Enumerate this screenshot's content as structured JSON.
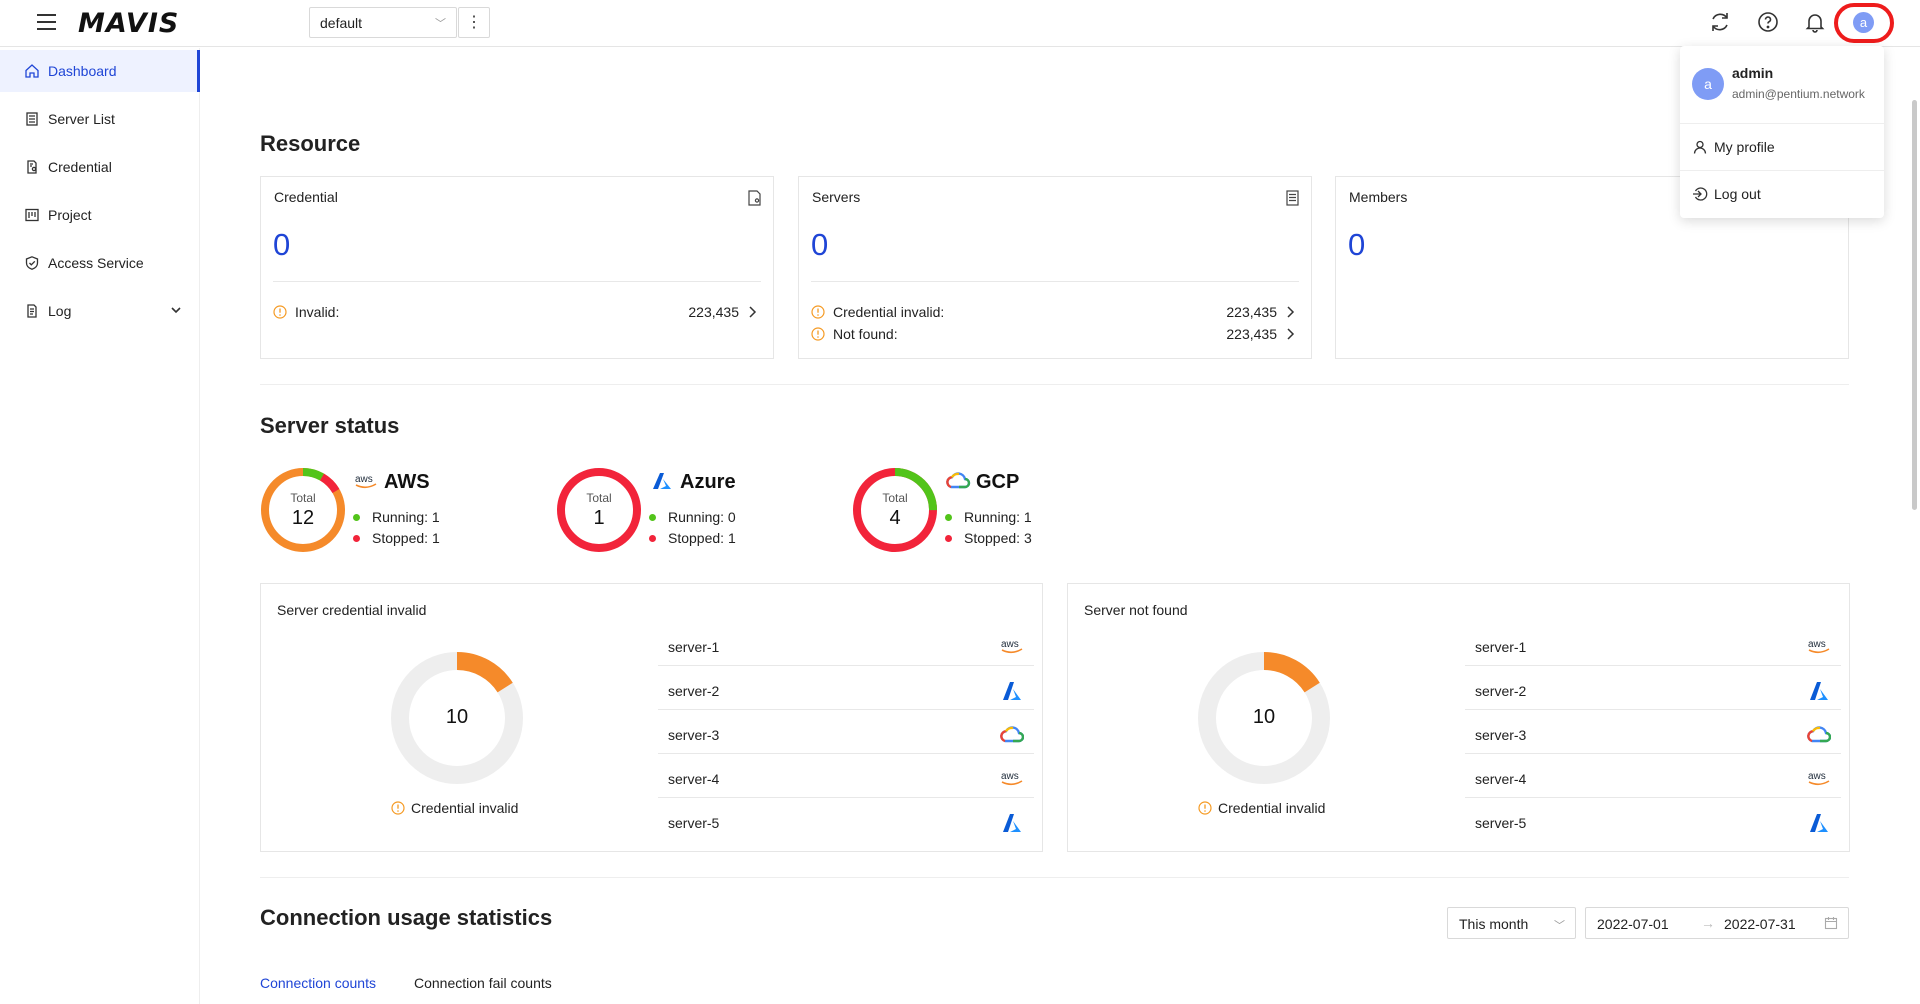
{
  "header": {
    "logo": "MAVIS",
    "project_selector": "default",
    "more_menu": "⋮",
    "user_avatar_letter": "a"
  },
  "sidebar": {
    "items": [
      {
        "label": "Dashboard",
        "icon": "home-icon",
        "active": true
      },
      {
        "label": "Server List",
        "icon": "server-list-icon"
      },
      {
        "label": "Credential",
        "icon": "credential-icon"
      },
      {
        "label": "Project",
        "icon": "project-icon"
      },
      {
        "label": "Access Service",
        "icon": "shield-icon"
      },
      {
        "label": "Log",
        "icon": "log-icon",
        "expandable": true
      }
    ]
  },
  "resource": {
    "title": "Resource",
    "cards": [
      {
        "title": "Credential",
        "value": "0",
        "rows": [
          {
            "label": "Invalid:",
            "value": "223,435"
          }
        ]
      },
      {
        "title": "Servers",
        "value": "0",
        "rows": [
          {
            "label": "Credential invalid:",
            "value": "223,435"
          },
          {
            "label": "Not found:",
            "value": "223,435"
          }
        ]
      },
      {
        "title": "Members",
        "value": "0",
        "rows": []
      }
    ]
  },
  "server_status": {
    "title": "Server status",
    "total_label": "Total",
    "providers": [
      {
        "name": "AWS",
        "total": "12",
        "running": "Running: 1",
        "stopped": "Stopped: 1",
        "running_count": 1,
        "stopped_count": 1
      },
      {
        "name": "Azure",
        "total": "1",
        "running": "Running: 0",
        "stopped": "Stopped: 1",
        "running_count": 0,
        "stopped_count": 1
      },
      {
        "name": "GCP",
        "total": "4",
        "running": "Running: 1",
        "stopped": "Stopped: 3",
        "running_count": 1,
        "stopped_count": 3
      }
    ]
  },
  "panels": [
    {
      "title": "Server credential invalid",
      "total": "10",
      "legend": "Credential invalid",
      "servers": [
        {
          "name": "server-1",
          "provider": "aws"
        },
        {
          "name": "server-2",
          "provider": "azure"
        },
        {
          "name": "server-3",
          "provider": "gcp"
        },
        {
          "name": "server-4",
          "provider": "aws"
        },
        {
          "name": "server-5",
          "provider": "azure"
        }
      ]
    },
    {
      "title": "Server not found",
      "total": "10",
      "legend": "Credential invalid",
      "servers": [
        {
          "name": "server-1",
          "provider": "aws"
        },
        {
          "name": "server-2",
          "provider": "azure"
        },
        {
          "name": "server-3",
          "provider": "gcp"
        },
        {
          "name": "server-4",
          "provider": "aws"
        },
        {
          "name": "server-5",
          "provider": "azure"
        }
      ]
    }
  ],
  "usage": {
    "title": "Connection usage statistics",
    "range_select": "This month",
    "date_from": "2022-07-01",
    "date_to": "2022-07-31",
    "tabs": [
      "Connection counts",
      "Connection fail counts"
    ]
  },
  "user_menu": {
    "name": "admin",
    "email": "admin@pentium.network",
    "avatar_letter": "a",
    "items": [
      "My profile",
      "Log out"
    ]
  },
  "colors": {
    "accent": "#1f45d6",
    "aws_orange": "#f58a2a",
    "stopped_red": "#f2243a",
    "running_green": "#52c41a",
    "warn_orange": "#f59a23"
  }
}
